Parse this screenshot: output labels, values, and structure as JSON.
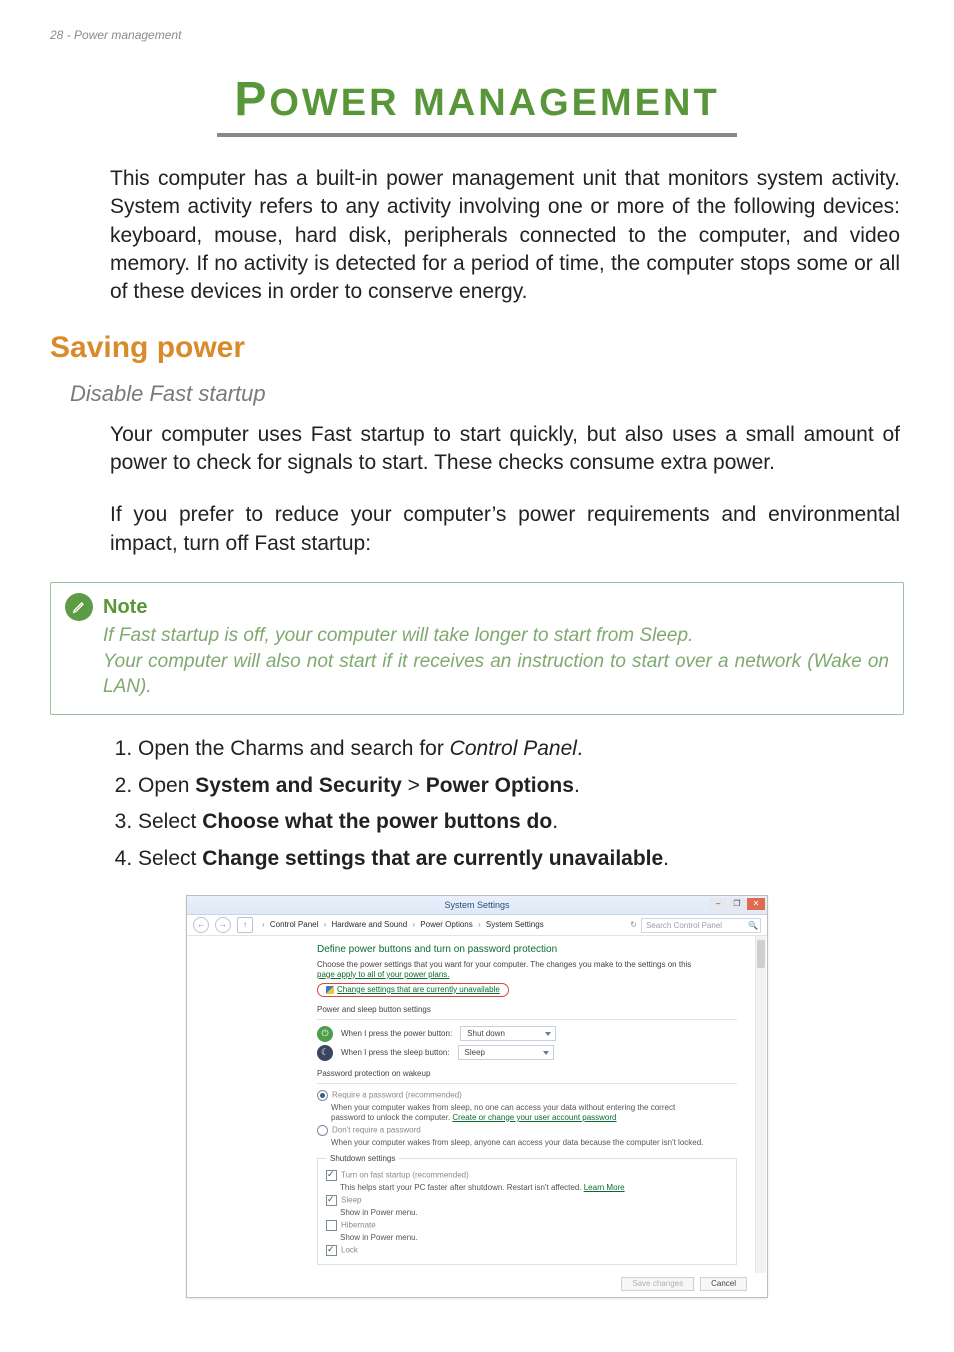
{
  "runningHead": "28 - Power management",
  "title_drop": "P",
  "title_rest": "OWER MANAGEMENT",
  "intro": "This computer has a built-in power management unit that monitors system activity. System activity refers to any activity involving one or more of the following devices: keyboard, mouse, hard disk, peripherals connected to the computer, and video memory. If no activity is detected for a period of time, the computer stops some or all of these devices in order to conserve energy.",
  "h2": "Saving power",
  "h3": "Disable Fast startup",
  "para1": "Your computer uses Fast startup to start quickly, but also uses a small amount of power to check for signals to start. These checks consume extra power.",
  "para2": "If you prefer to reduce your computer’s power requirements and environmental impact, turn off Fast startup:",
  "note": {
    "label": "Note",
    "line1": "If Fast startup is off, your computer will take longer to start from Sleep.",
    "line2": "Your computer will also not start if it receives an instruction to start over a network (Wake on LAN)."
  },
  "steps": {
    "s1a": "Open the Charms and search for ",
    "s1b": "Control Panel",
    "s1c": ".",
    "s2a": "Open ",
    "s2b": "System and Security",
    "s2c": " > ",
    "s2d": "Power Options",
    "s2e": ".",
    "s3a": "Select ",
    "s3b": "Choose what the power buttons do",
    "s3c": ".",
    "s4a": "Select ",
    "s4b": "Change settings that are currently unavailable",
    "s4c": "."
  },
  "shot": {
    "windowTitle": "System Settings",
    "crumb": {
      "c1": "Control Panel",
      "c2": "Hardware and Sound",
      "c3": "Power Options",
      "c4": "System Settings",
      "sep": "›"
    },
    "refreshGlyph": "↻",
    "searchPlaceholder": "Search Control Panel",
    "heading": "Define power buttons and turn on password protection",
    "headSub1": "Choose the power settings that you want for your computer. The changes you make to the settings on this",
    "headSub2": "page apply to all of your power plans.",
    "changeLink": "Change settings that are currently unavailable",
    "sec1": "Power and sleep button settings",
    "rowPowerLabel": "When I press the power button:",
    "rowPowerValue": "Shut down",
    "rowSleepLabel": "When I press the sleep button:",
    "rowSleepValue": "Sleep",
    "sec2": "Password protection on wakeup",
    "reqPwd": "Require a password (recommended)",
    "reqPwdDesc1": "When your computer wakes from sleep, no one can access your data without entering the correct",
    "reqPwdDesc2a": "password to unlock the computer. ",
    "reqPwdDesc2b": "Create or change your user account password",
    "noPwd": "Don't require a password",
    "noPwdDesc": "When your computer wakes from sleep, anyone can access your data because the computer isn't locked.",
    "sec3": "Shutdown settings",
    "fastStart": "Turn on fast startup (recommended)",
    "fastStartDesc1": "This helps start your PC faster after shutdown. Restart isn't affected. ",
    "fastStartDesc2": "Learn More",
    "optSleep": "Sleep",
    "optSleepDesc": "Show in Power menu.",
    "optHibernate": "Hibernate",
    "optHibernateDesc": "Show in Power menu.",
    "optLock": "Lock",
    "btnSave": "Save changes",
    "btnCancel": "Cancel",
    "ctrlMin": "–",
    "ctrlMax": "❐",
    "ctrlClose": "✕",
    "backGlyph": "←",
    "fwdGlyph": "→",
    "upGlyph": "↑",
    "powerGlyph": "⏻",
    "moonGlyph": "☾",
    "magGlyph": "🔍"
  }
}
